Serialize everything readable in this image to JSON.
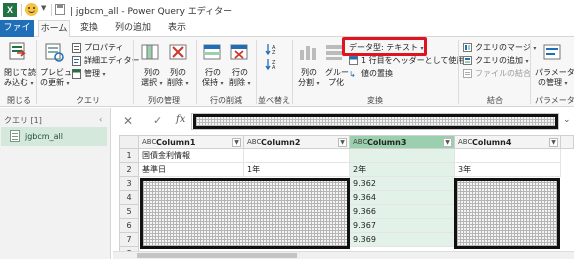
{
  "titlebar": {
    "app_icon": "excel-icon",
    "title": "| jgbcm_all - Power Query エディター"
  },
  "tabs": [
    {
      "label": "ファイル"
    },
    {
      "label": "ホーム"
    },
    {
      "label": "変換"
    },
    {
      "label": "列の追加"
    },
    {
      "label": "表示"
    }
  ],
  "ribbon": {
    "close": {
      "line1": "閉じて読",
      "line2": "み込む",
      "group": "閉じる"
    },
    "query": {
      "preview_line1": "プレビュー",
      "preview_line2": "の更新",
      "properties": "プロパティ",
      "advanced_editor": "詳細エディター",
      "manage": "管理",
      "group": "クエリ"
    },
    "columns": {
      "choose_line1": "列の",
      "choose_line2": "選択",
      "remove_line1": "列の",
      "remove_line2": "削除",
      "group": "列の管理"
    },
    "rows": {
      "keep_line1": "行の",
      "keep_line2": "保持",
      "remove_line1": "行の",
      "remove_line2": "削除",
      "group": "行の削減"
    },
    "sort": {
      "group": "並べ替え"
    },
    "transform": {
      "split_line1": "列の",
      "split_line2": "分割",
      "group_line1": "グルー",
      "group_line2": "プ化",
      "data_type": "データ型: テキスト",
      "use_first_row": "1 行目をヘッダーとして使用",
      "replace_values": "値の置換",
      "group": "変換"
    },
    "combine": {
      "merge": "クエリのマージ",
      "append": "クエリの追加",
      "combine_files": "ファイルの結合",
      "group": "結合"
    },
    "params": {
      "line1": "パラメーター",
      "line2": "の管理",
      "group": "パラメーター"
    }
  },
  "queries": {
    "header": "クエリ [1]",
    "items": [
      {
        "label": "jgbcm_all"
      }
    ]
  },
  "grid": {
    "columns": [
      {
        "type": "ABC",
        "name": "Column1",
        "selected": false
      },
      {
        "type": "ABC",
        "name": "Column2",
        "selected": false
      },
      {
        "type": "ABC",
        "name": "Column3",
        "selected": true
      },
      {
        "type": "ABC",
        "name": "Column4",
        "selected": false
      }
    ],
    "rows": [
      {
        "n": "1",
        "cells": [
          "国債金利情報",
          "",
          "",
          ""
        ]
      },
      {
        "n": "2",
        "cells": [
          "基準日",
          "1年",
          "2年",
          "3年"
        ]
      },
      {
        "n": "3",
        "cells": [
          "",
          "",
          "9.362",
          ""
        ]
      },
      {
        "n": "4",
        "cells": [
          "",
          "",
          "9.364",
          ""
        ]
      },
      {
        "n": "5",
        "cells": [
          "",
          "",
          "9.366",
          ""
        ]
      },
      {
        "n": "6",
        "cells": [
          "",
          "",
          "9.367",
          ""
        ]
      },
      {
        "n": "7",
        "cells": [
          "",
          "",
          "9.369",
          ""
        ]
      },
      {
        "n": "8",
        "cells": [
          "",
          "",
          "",
          ""
        ]
      }
    ]
  }
}
